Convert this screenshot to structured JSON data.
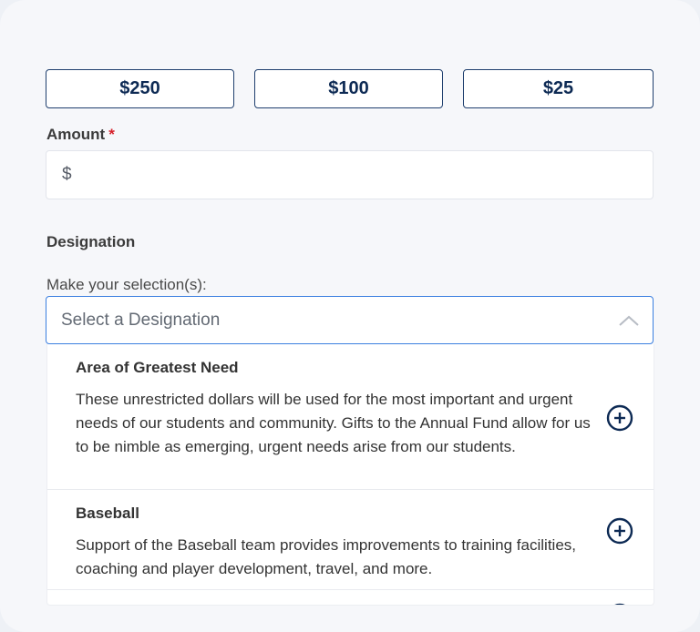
{
  "amounts": {
    "options": [
      "$250",
      "$100",
      "$25"
    ]
  },
  "amount_field": {
    "label": "Amount",
    "required_marker": "*",
    "currency_prefix": "$",
    "value": ""
  },
  "designation": {
    "section_title": "Designation",
    "selection_hint": "Make your selection(s):",
    "placeholder": "Select a Designation",
    "options": [
      {
        "title": "Area of Greatest Need",
        "description": "These unrestricted dollars will be used for the most important and urgent needs of our students and community. Gifts to the Annual Fund allow for us to be nimble as emerging, urgent needs arise from our students."
      },
      {
        "title": "Baseball",
        "description": "Support of the Baseball team provides improvements to training facilities, coaching and player development, travel, and more."
      }
    ]
  },
  "colors": {
    "brand_navy": "#0d2a54",
    "focus_blue": "#3b7fe0",
    "required_red": "#d6202a"
  },
  "icons": {
    "add": "plus-circle-icon",
    "expand_state": "chevron-up-icon"
  }
}
